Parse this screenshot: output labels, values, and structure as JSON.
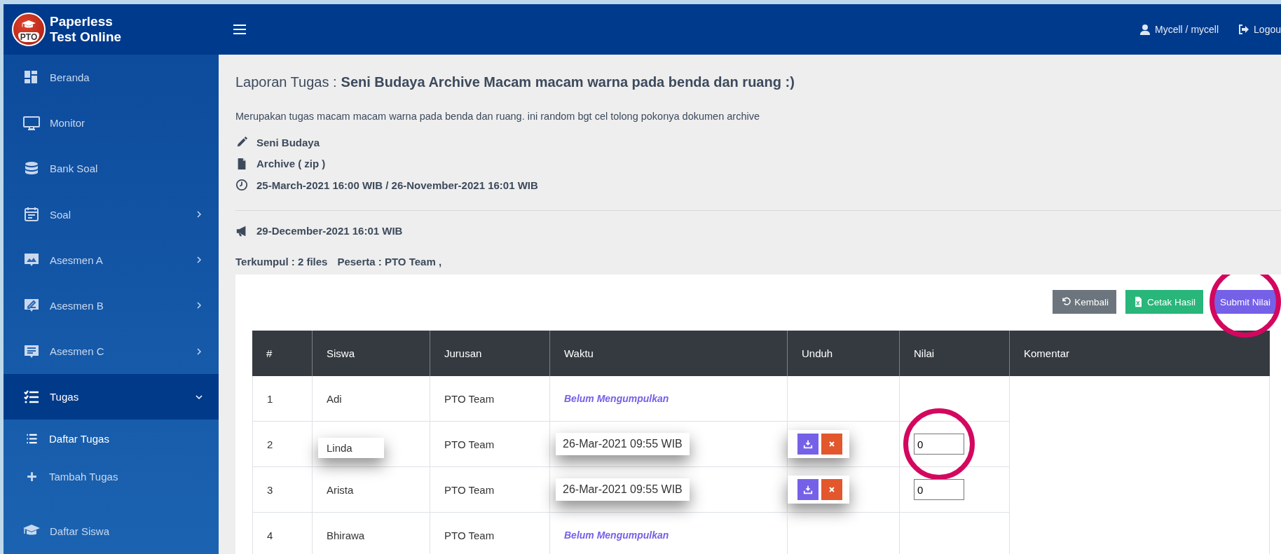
{
  "brand": {
    "logo_text": "PTO",
    "line_1": "Paperless",
    "line_2": "Test Online"
  },
  "topbar": {
    "user": "Mycell / mycell",
    "logout": "Logou"
  },
  "sidebar": {
    "items": [
      {
        "label": "Beranda",
        "has_submenu": false,
        "expanded": false,
        "selected": false
      },
      {
        "label": "Monitor",
        "has_submenu": false,
        "expanded": false,
        "selected": false
      },
      {
        "label": "Bank Soal",
        "has_submenu": false,
        "expanded": false,
        "selected": false
      },
      {
        "label": "Soal",
        "has_submenu": true,
        "expanded": false,
        "selected": false
      },
      {
        "label": "Asesmen A",
        "has_submenu": true,
        "expanded": false,
        "selected": false
      },
      {
        "label": "Asesmen B",
        "has_submenu": true,
        "expanded": false,
        "selected": false
      },
      {
        "label": "Asesmen C",
        "has_submenu": true,
        "expanded": false,
        "selected": false
      },
      {
        "label": "Tugas",
        "has_submenu": true,
        "expanded": true,
        "selected": true,
        "children": [
          {
            "label": "Daftar Tugas",
            "selected": true
          },
          {
            "label": "Tambah Tugas",
            "selected": false
          }
        ]
      },
      {
        "label": "Daftar Siswa",
        "has_submenu": false,
        "expanded": false,
        "selected": false
      }
    ]
  },
  "report": {
    "title_prefix": "Laporan Tugas :",
    "title": "Seni Budaya Archive Macam macam warna pada benda dan ruang :)",
    "description": "Merupakan tugas macam macam warna pada benda dan ruang. ini random bgt cel tolong pokonya dokumen archive",
    "meta": [
      "Seni Budaya",
      "Archive ( zip )",
      "25-March-2021 16:00 WIB / 26-November-2021 16:01 WIB"
    ],
    "announcement": "29-December-2021 16:01 WIB",
    "summary": [
      "Terkumpul : 2 files",
      "Peserta : PTO Team ,"
    ]
  },
  "buttons": [
    {
      "label": "Kembali",
      "kind": "back",
      "circled": false
    },
    {
      "label": "Cetak Hasil",
      "kind": "excel",
      "circled": false
    },
    {
      "label": "Submit Nilai",
      "kind": "submit",
      "circled": true
    }
  ],
  "table": {
    "columns": [
      "#",
      "Siswa",
      "Jurusan",
      "Waktu",
      "Unduh",
      "Nilai",
      "Komentar"
    ],
    "rows": [
      {
        "no": "1",
        "siswa": "Adi",
        "name_raised": false,
        "jurusan": "PTO Team",
        "submitted": false,
        "waktu": "Belum Mengumpulkan"
      },
      {
        "no": "2",
        "siswa": "Linda",
        "name_raised": true,
        "jurusan": "PTO Team",
        "submitted": true,
        "waktu": "26-Mar-2021 09:55 WIB",
        "nilai": "0",
        "circled": true
      },
      {
        "no": "3",
        "siswa": "Arista",
        "name_raised": false,
        "jurusan": "PTO Team",
        "submitted": true,
        "waktu": "26-Mar-2021 09:55 WIB",
        "nilai": "0",
        "circled": false
      },
      {
        "no": "4",
        "siswa": "Bhirawa",
        "name_raised": false,
        "jurusan": "PTO Team",
        "submitted": false,
        "waktu": "Belum Mengumpulkan"
      }
    ]
  }
}
